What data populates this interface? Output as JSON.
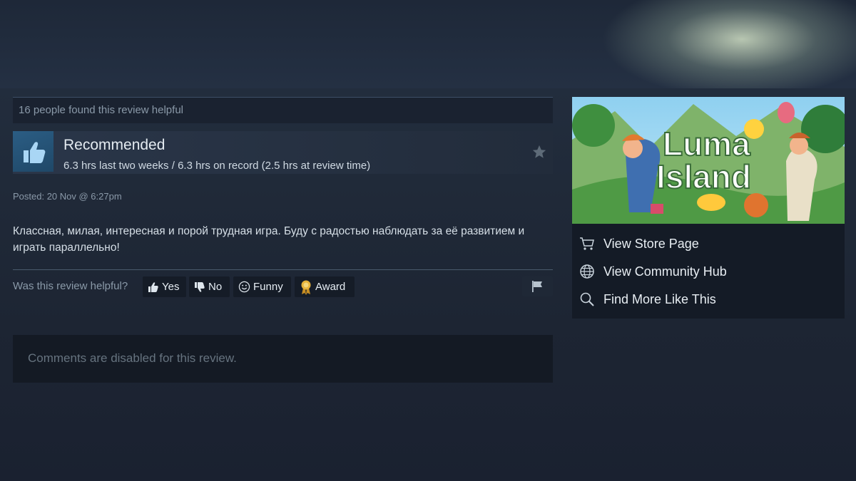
{
  "review": {
    "helpful_count_text": "16 people found this review helpful",
    "recommendation": "Recommended",
    "hours": "6.3 hrs last two weeks / 6.3 hrs on record (2.5 hrs at review time)",
    "posted": "Posted: 20 Nov @ 6:27pm",
    "text": "Классная, милая, интересная и порой трудная игра. Буду с радостью наблюдать за её развитием и играть параллельно!"
  },
  "vote": {
    "question": "Was this review helpful?",
    "yes_label": "Yes",
    "no_label": "No",
    "funny_label": "Funny",
    "award_label": "Award"
  },
  "comments": {
    "disabled_text": "Comments are disabled for this review."
  },
  "game": {
    "capsule_title_line1": "Luma",
    "capsule_title_line2": "Island"
  },
  "sidebar_links": [
    {
      "label": "View Store Page",
      "icon": "cart-icon"
    },
    {
      "label": "View Community Hub",
      "icon": "globe-icon"
    },
    {
      "label": "Find More Like This",
      "icon": "search-icon"
    }
  ],
  "colors": {
    "background": "#1b2331",
    "thumb_tile": "#2b5d84",
    "award_gold": "#e8b33a"
  }
}
